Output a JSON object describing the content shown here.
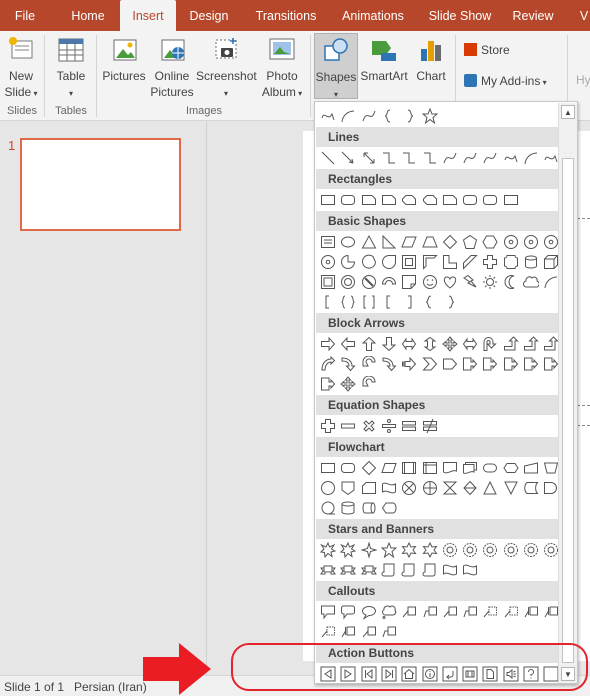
{
  "tabs": [
    "File",
    "Home",
    "Insert",
    "Design",
    "Transitions",
    "Animations",
    "Slide Show",
    "Review",
    "V"
  ],
  "active_tab": "Insert",
  "ribbon": {
    "new_slide": [
      "New",
      "Slide"
    ],
    "table": "Table",
    "pictures": "Pictures",
    "online_pictures": [
      "Online",
      "Pictures"
    ],
    "screenshot": "Screenshot",
    "photo_album": [
      "Photo",
      "Album"
    ],
    "shapes": "Shapes",
    "smartart": "SmartArt",
    "chart": "Chart",
    "store": "Store",
    "my_addins": "My Add-ins",
    "hy": "Hy",
    "groups": {
      "slides": "Slides",
      "tables": "Tables",
      "images": "Images"
    }
  },
  "gallery": {
    "categories": [
      "Lines",
      "Rectangles",
      "Basic Shapes",
      "Block Arrows",
      "Equation Shapes",
      "Flowchart",
      "Stars and Banners",
      "Callouts",
      "Action Buttons"
    ]
  },
  "slide_panel": {
    "slide_number": "1"
  },
  "status_bar": {
    "slide_info": "Slide 1 of 1",
    "language": "Persian (Iran)"
  },
  "colors": {
    "accent": "#b7472a",
    "annotation": "#e3232d",
    "thumb_border": "#e0694a"
  }
}
